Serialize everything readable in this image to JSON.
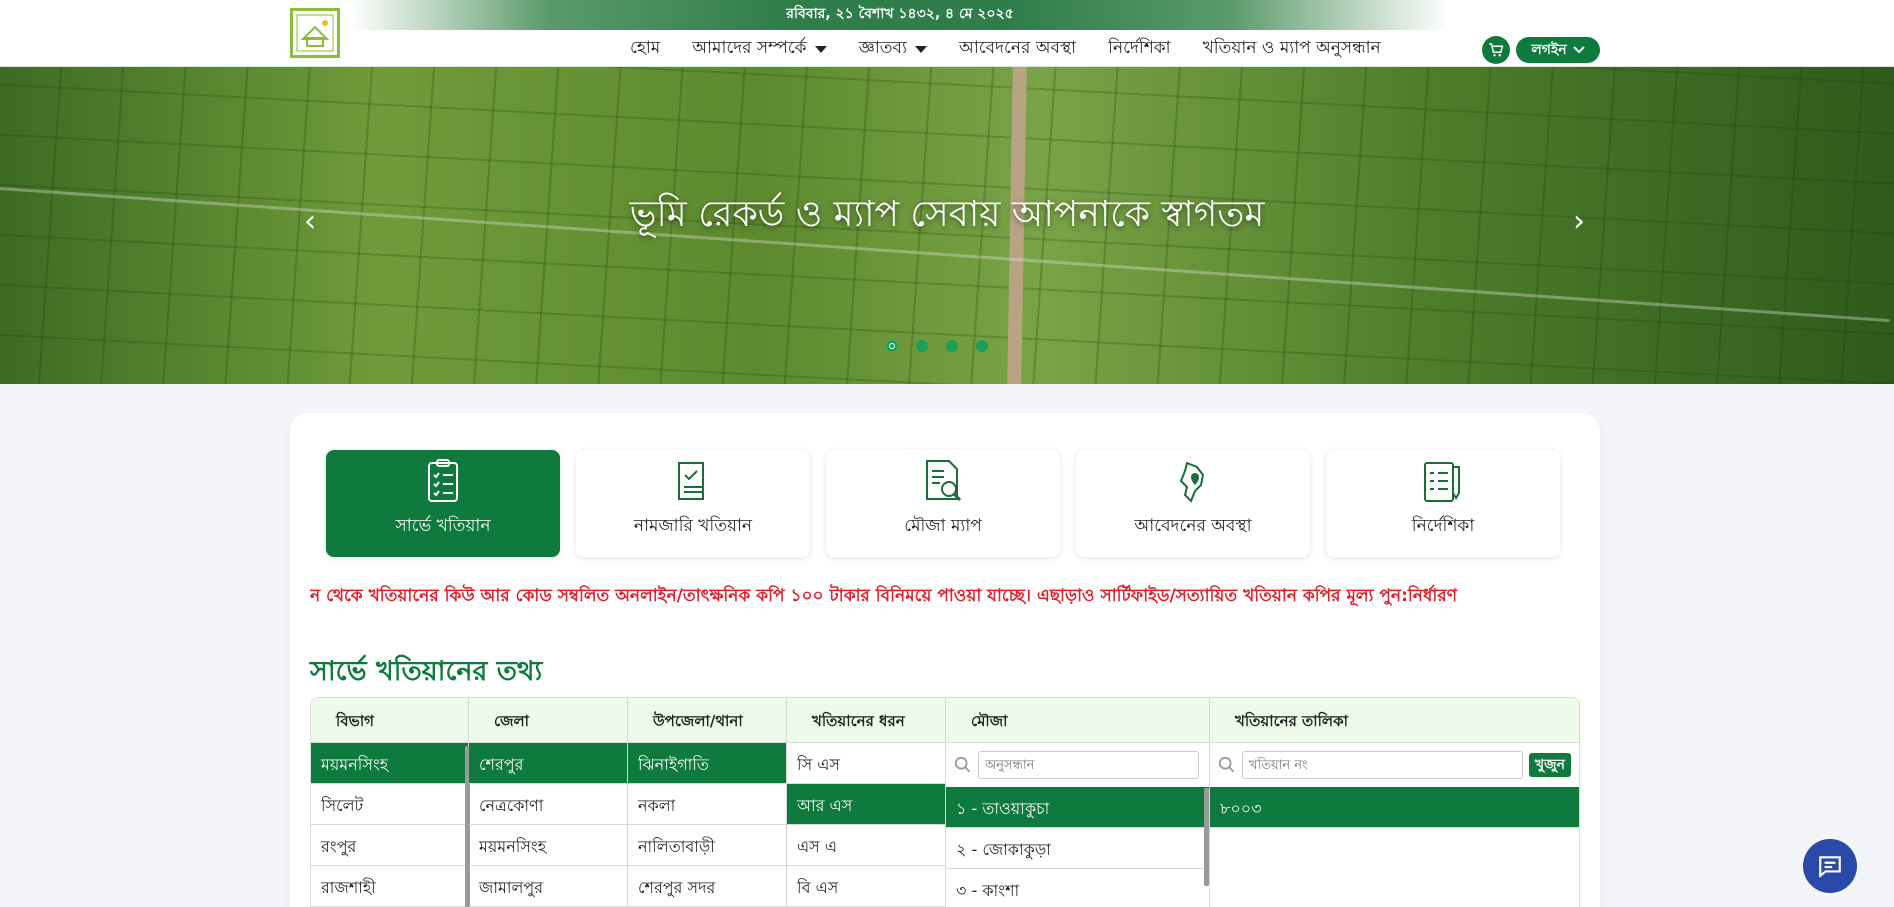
{
  "header": {
    "date": "রবিবার, ২১ বৈশাখ ১৪৩২, ৪ মে ২০২৫",
    "nav": [
      {
        "label": "হোম",
        "dropdown": false
      },
      {
        "label": "আমাদের সম্পর্কে",
        "dropdown": true
      },
      {
        "label": "জ্ঞাতব্য",
        "dropdown": true
      },
      {
        "label": "আবেদনের অবস্থা",
        "dropdown": false
      },
      {
        "label": "নির্দেশিকা",
        "dropdown": false
      },
      {
        "label": "খতিয়ান ও ম্যাপ অনুসন্ধান",
        "dropdown": false
      }
    ],
    "login_label": "লগইন"
  },
  "hero": {
    "title": "ভূমি রেকর্ড ও ম্যাপ সেবায় আপনাকে স্বাগতম",
    "prev_arrow": "‹",
    "next_arrow": "›",
    "slides": 4,
    "active_slide": 1
  },
  "services": [
    {
      "label": "সার্ভে খতিয়ান",
      "icon": "clipboard-checklist-icon",
      "active": true
    },
    {
      "label": "নামজারি খতিয়ান",
      "icon": "document-check-icon",
      "active": false
    },
    {
      "label": "মৌজা ম্যাপ",
      "icon": "document-search-icon",
      "active": false
    },
    {
      "label": "আবেদনের অবস্থা",
      "icon": "map-pin-icon",
      "active": false
    },
    {
      "label": "নির্দেশিকা",
      "icon": "checklist-pen-icon",
      "active": false
    }
  ],
  "notice": "ন থেকে খতিয়ানের কিউ আর কোড সম্বলিত অনলাইন/তাৎক্ষনিক কপি ১০০ টাকার বিনিময়ে পাওয়া যাচ্ছে। এছাড়াও সার্টিফাইড/সত্যায়িত খতিয়ান কপির মূল্য পুন:নির্ধারণ",
  "section_title": "সার্ভে খতিয়ানের তথ্য",
  "table": {
    "headers": {
      "division": "বিভাগ",
      "district": "জেলা",
      "upazila": "উপজেলা/থানা",
      "khatian_type": "খতিয়ানের ধরন",
      "mouza": "মৌজা",
      "khatian_list": "খতিয়ানের তালিকা"
    },
    "division": [
      "ময়মনসিংহ",
      "সিলেট",
      "রংপুর",
      "রাজশাহী"
    ],
    "district": [
      "শেরপুর",
      "নেত্রকোণা",
      "ময়মনসিংহ",
      "জামালপুর"
    ],
    "upazila": [
      "ঝিনাইগাতি",
      "নকলা",
      "নালিতাবাড়ী",
      "শেরপুর সদর"
    ],
    "khatian_type": [
      "সি এস",
      "আর এস",
      "এস এ",
      "বি এস"
    ],
    "mouza": [
      "১ - তাওয়াকুচা",
      "২ - জোকাকুড়া",
      "৩ - কাংশা"
    ],
    "mouza_search_placeholder": "অনুসন্ধান",
    "khatian_search_placeholder": "খতিয়ান নং",
    "find_label": "খুজুন",
    "khatian_results": [
      "৮০০৩"
    ]
  },
  "colors": {
    "primary": "#0e7a3e",
    "notice": "#e0202a",
    "chat": "#2a49a8"
  }
}
